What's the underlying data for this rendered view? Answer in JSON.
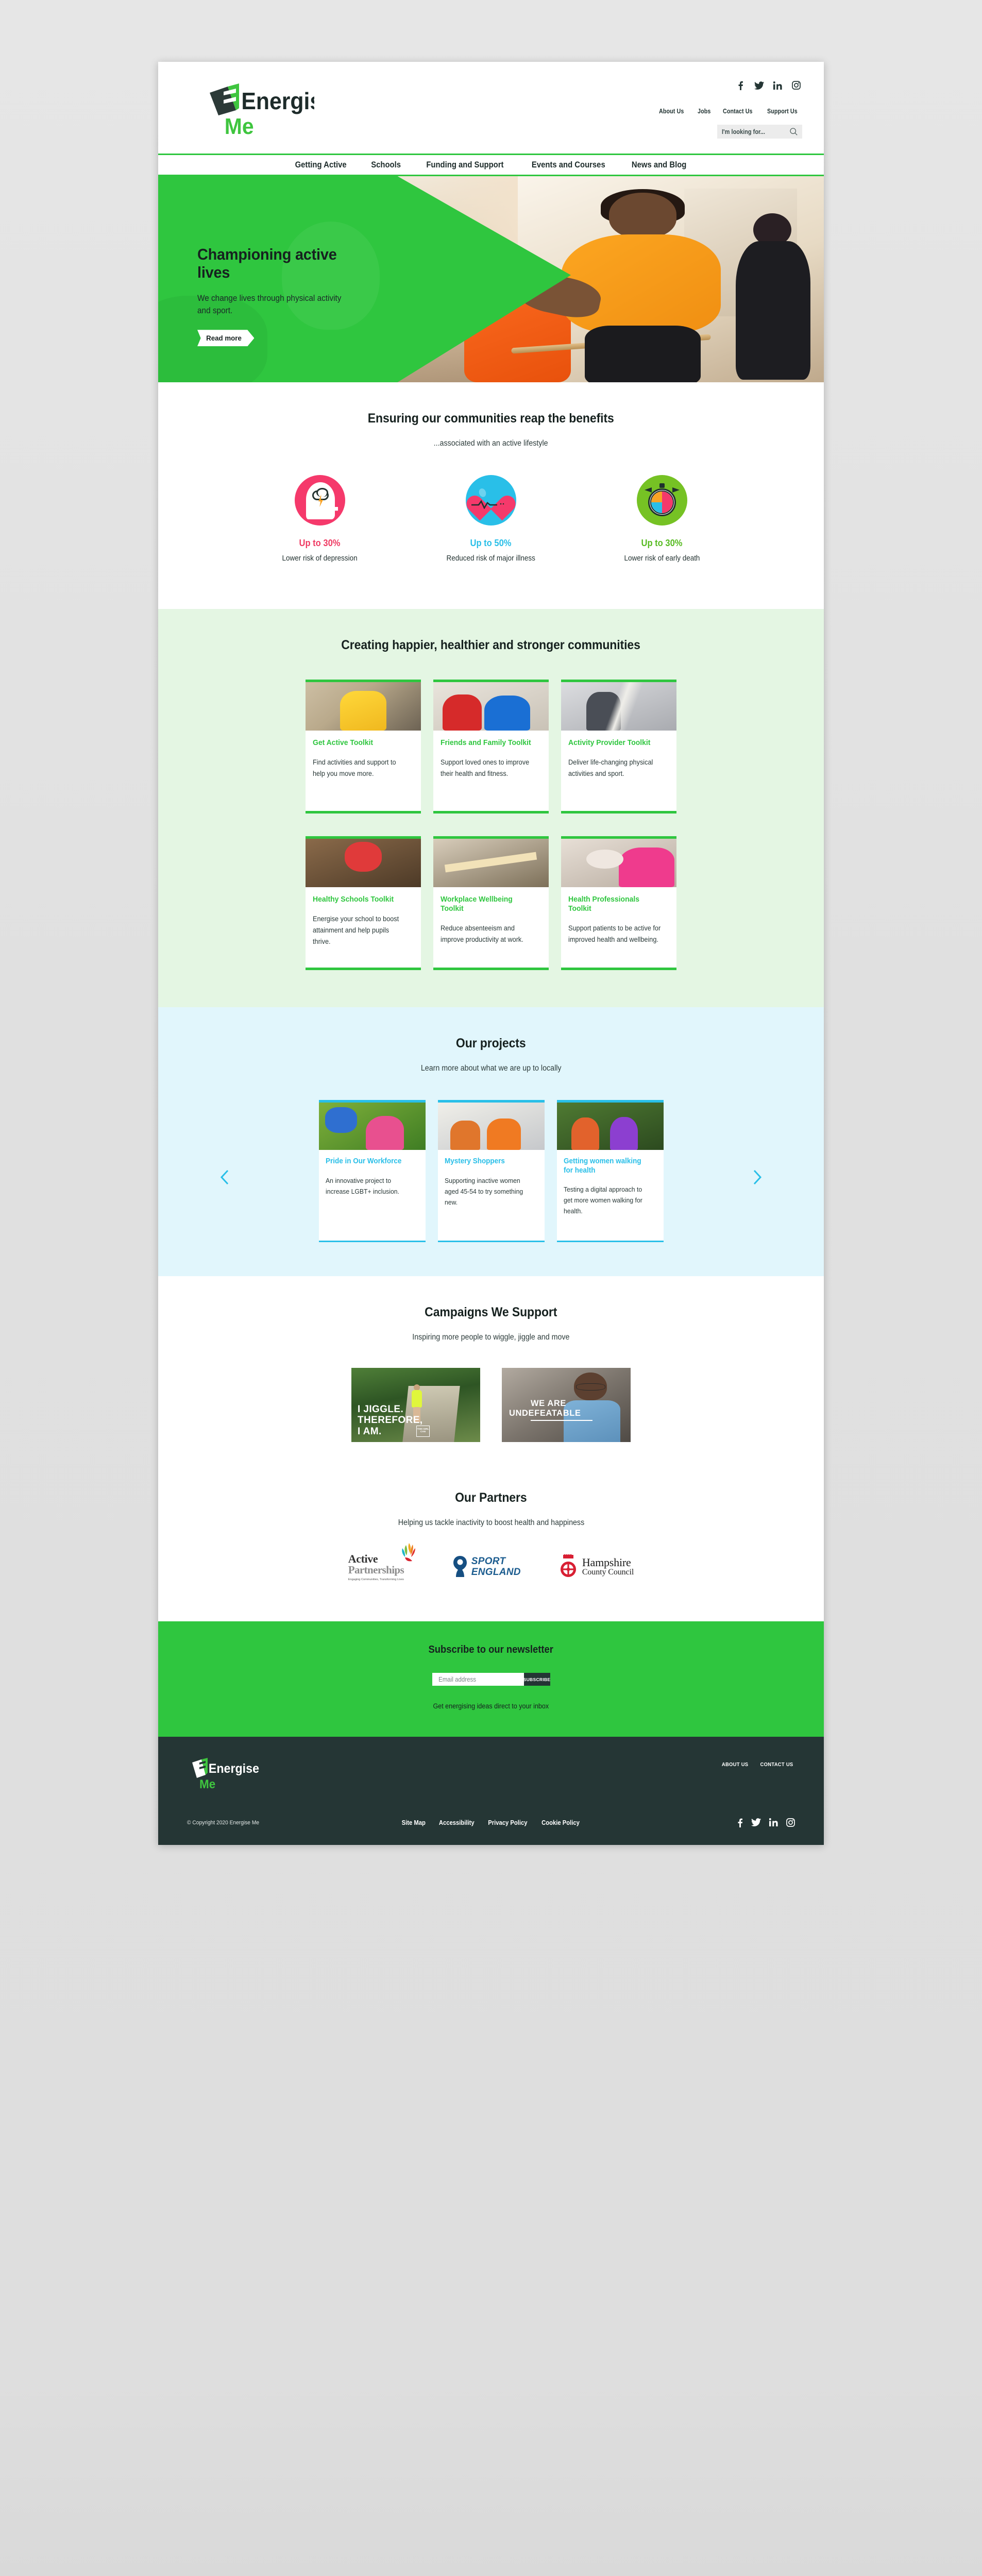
{
  "brand": {
    "name_line1": "Energise",
    "name_line2": "Me",
    "green": "#2fc63f",
    "dark": "#243534"
  },
  "header": {
    "social": [
      {
        "name": "facebook-icon",
        "label": "Facebook"
      },
      {
        "name": "twitter-icon",
        "label": "Twitter"
      },
      {
        "name": "linkedin-icon",
        "label": "LinkedIn"
      },
      {
        "name": "instagram-icon",
        "label": "Instagram"
      }
    ],
    "util_nav": [
      "About Us",
      "Jobs",
      "Contact Us",
      "Support Us"
    ],
    "search": {
      "placeholder": "I'm looking for...",
      "value": ""
    }
  },
  "nav": {
    "items": [
      "Getting Active",
      "Schools",
      "Funding and Support",
      "Events and Courses",
      "News and Blog"
    ]
  },
  "hero": {
    "title": "Championing active lives",
    "subtitle": "We change lives through physical activity and sport.",
    "button": "Read more"
  },
  "benefits": {
    "title": "Ensuring our communities reap the benefits",
    "subtitle": "...associated with an active lifestyle",
    "items": [
      {
        "icon": "brain-head-icon",
        "percent": "Up to 30%",
        "caption": "Lower risk of depression",
        "color": "#ef3b63",
        "circle": "#f5396b"
      },
      {
        "icon": "heartbeat-icon",
        "percent": "Up to 50%",
        "caption": "Reduced risk of major illness",
        "color": "#29bfe8",
        "circle": "#29bfe8"
      },
      {
        "icon": "stopwatch-pie-icon",
        "percent": "Up to 30%",
        "caption": "Lower risk of early death",
        "color": "#57bb22",
        "circle": "#76c224"
      }
    ]
  },
  "toolkits": {
    "title": "Creating happier, healthier and stronger communities",
    "cards": [
      {
        "title": "Get Active Toolkit",
        "text": "Find activities and support to help you move more.",
        "photo": "p-yellow",
        "photo_alt": "woman-stretching-photo"
      },
      {
        "title": "Friends and Family Toolkit",
        "text": "Support loved ones to improve their health and fitness.",
        "photo": "p-kids",
        "photo_alt": "young-people-sport-photo"
      },
      {
        "title": "Activity Provider Toolkit",
        "text": "Deliver life-changing physical activities and sport.",
        "photo": "p-gym",
        "photo_alt": "gym-coach-photo"
      },
      {
        "title": "Healthy Schools Toolkit",
        "text": "Energise your school to boost attainment and help pupils thrive.",
        "photo": "p-climb",
        "photo_alt": "child-climbing-photo"
      },
      {
        "title": "Workplace Wellbeing Toolkit",
        "text": "Reduce absenteeism and improve productivity at work.",
        "photo": "p-stretch",
        "photo_alt": "workplace-stretch-photo"
      },
      {
        "title": "Health Professionals Toolkit",
        "text": "Support patients to be active for improved health and wellbeing.",
        "photo": "p-senior",
        "photo_alt": "older-adults-photo"
      }
    ]
  },
  "projects": {
    "title": "Our projects",
    "subtitle": "Learn more about what we are up to locally",
    "prev_label": "‹",
    "next_label": "›",
    "cards": [
      {
        "title": "Pride in Our Workforce",
        "text": "An innovative project to increase LGBT+ inclusion.",
        "photo": "pp-climb",
        "photo_alt": "climbing-wall-photo"
      },
      {
        "title": "Mystery Shoppers",
        "text": "Supporting inactive women aged 45-54 to try something new.",
        "photo": "pp-gym",
        "photo_alt": "gym-women-photo"
      },
      {
        "title": "Getting women walking for health",
        "text": "Testing a digital approach to get more women walking for health.",
        "photo": "pp-walk",
        "photo_alt": "women-walking-photo"
      }
    ]
  },
  "campaigns": {
    "title": "Campaigns We Support",
    "subtitle": "Inspiring more people to wiggle, jiggle and move",
    "items": [
      {
        "name": "this-girl-can-campaign",
        "caption_line1": "I JIGGLE.",
        "caption_line2": "THEREFORE,",
        "caption_line3": "I AM.",
        "badge": "THIS GIRL CAN"
      },
      {
        "name": "we-are-undefeatable-campaign",
        "caption_line1": "WE ARE",
        "caption_line2": "UNDEFEATABLE"
      }
    ]
  },
  "partners": {
    "title": "Our Partners",
    "subtitle": "Helping us tackle inactivity to boost health and happiness",
    "logos": [
      {
        "name": "active-partnerships-logo",
        "line1": "Active",
        "line2": "Partnerships",
        "tagline": "Engaging Communities, Transforming Lives"
      },
      {
        "name": "sport-england-logo",
        "line1": "SPORT",
        "line2": "ENGLAND"
      },
      {
        "name": "hampshire-county-council-logo",
        "line1": "Hampshire",
        "line2": "County Council"
      }
    ]
  },
  "newsletter": {
    "title": "Subscribe to our newsletter",
    "email_placeholder": "Email address",
    "email_value": "",
    "button": "SUBSCRIBE",
    "note": "Get energising ideas direct to your inbox"
  },
  "footer": {
    "links": [
      "ABOUT US",
      "CONTACT US"
    ],
    "copyright": "© Copyright 2020 Energise Me",
    "legal": [
      "Site Map",
      "Accessibility",
      "Privacy Policy",
      "Cookie Policy"
    ],
    "social": [
      {
        "name": "facebook-icon",
        "label": "Facebook"
      },
      {
        "name": "twitter-icon",
        "label": "Twitter"
      },
      {
        "name": "linkedin-icon",
        "label": "LinkedIn"
      },
      {
        "name": "instagram-icon",
        "label": "Instagram"
      }
    ]
  }
}
